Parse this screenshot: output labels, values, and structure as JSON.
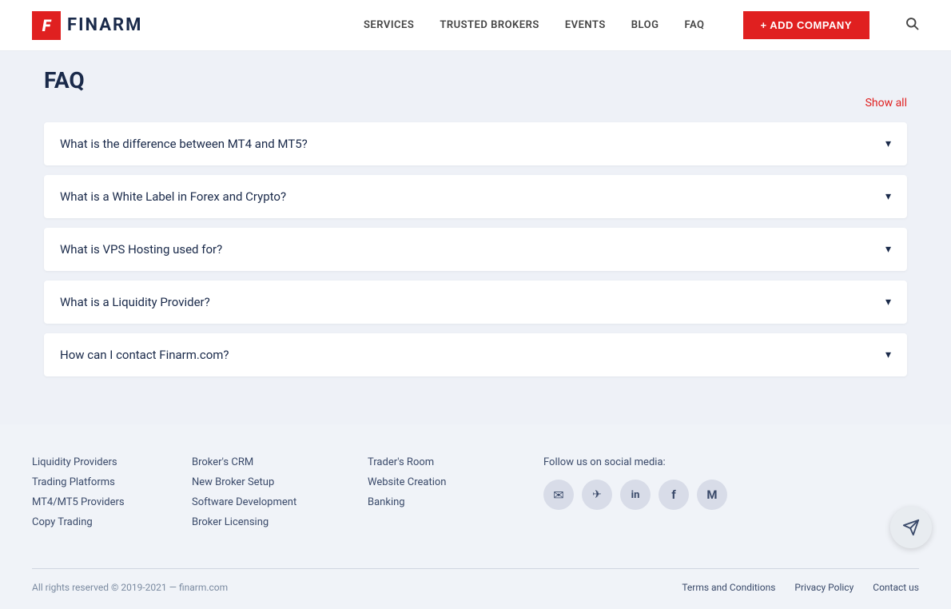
{
  "header": {
    "logo_letter": "F",
    "logo_text": "FINARM",
    "nav_links": [
      {
        "label": "SERVICES",
        "id": "services"
      },
      {
        "label": "TRUSTED BROKERS",
        "id": "trusted-brokers"
      },
      {
        "label": "EVENTS",
        "id": "events"
      },
      {
        "label": "BLOG",
        "id": "blog"
      },
      {
        "label": "FAQ",
        "id": "faq"
      }
    ],
    "add_company_label": "+ ADD COMPANY",
    "search_icon": "🔍"
  },
  "page": {
    "title": "FAQ",
    "show_all": "Show all"
  },
  "faq": {
    "items": [
      {
        "id": "faq1",
        "question": "What is the difference between MT4 and MT5?"
      },
      {
        "id": "faq2",
        "question": "What is a White Label in Forex and Crypto?"
      },
      {
        "id": "faq3",
        "question": "What is VPS Hosting used for?"
      },
      {
        "id": "faq4",
        "question": "What is a Liquidity Provider?"
      },
      {
        "id": "faq5",
        "question": "How can I contact Finarm.com?"
      }
    ]
  },
  "footer": {
    "col1_links": [
      {
        "label": "Liquidity Providers"
      },
      {
        "label": "Trading Platforms"
      },
      {
        "label": "MT4/MT5 Providers"
      },
      {
        "label": "Copy Trading"
      }
    ],
    "col2_links": [
      {
        "label": "Broker's CRM"
      },
      {
        "label": "New Broker Setup"
      },
      {
        "label": "Software Development"
      },
      {
        "label": "Broker Licensing"
      }
    ],
    "col3_links": [
      {
        "label": "Trader's Room"
      },
      {
        "label": "Website Creation"
      },
      {
        "label": "Banking"
      }
    ],
    "social_heading": "Follow us on social media:",
    "social_icons": [
      {
        "name": "email",
        "symbol": "✉"
      },
      {
        "name": "telegram",
        "symbol": "✈"
      },
      {
        "name": "linkedin",
        "symbol": "in"
      },
      {
        "name": "facebook",
        "symbol": "f"
      },
      {
        "name": "medium",
        "symbol": "M"
      }
    ],
    "copyright": "All rights reserved © 2019-2021 — finarm.com",
    "bottom_links": [
      {
        "label": "Terms and Conditions"
      },
      {
        "label": "Privacy Policy"
      },
      {
        "label": "Contact us"
      }
    ]
  }
}
